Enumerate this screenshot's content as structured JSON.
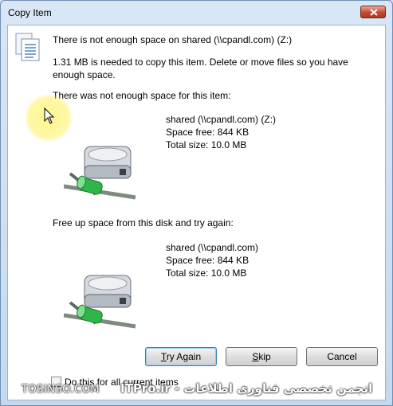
{
  "window": {
    "title": "Copy Item"
  },
  "message": {
    "main": "There is not enough space on shared (\\\\cpandl.com) (Z:)",
    "detail": "1.31 MB is needed to copy this item. Delete or move files so you have enough space."
  },
  "section1": {
    "heading": "There was not enough space for this item:",
    "drive_name": "shared (\\\\cpandl.com) (Z:)",
    "space_free": "Space free: 844 KB",
    "total_size": "Total size: 10.0 MB"
  },
  "section2": {
    "heading": "Free up space from this disk and try again:",
    "drive_name": "shared (\\\\cpandl.com)",
    "space_free": "Space free: 844 KB",
    "total_size": "Total size: 10.0 MB"
  },
  "buttons": {
    "try_again_accel": "T",
    "try_again_rest": "ry Again",
    "skip_accel": "S",
    "skip_rest": "kip",
    "cancel": "Cancel"
  },
  "checkbox": {
    "label": "Do this for all current items"
  },
  "watermark": {
    "left": "TOSINSO.COM",
    "right": "انجمن تخصصی فناوری اطلاعات - ITPro.ir"
  },
  "icons": {
    "close": "close-icon",
    "document": "copy-document-icon",
    "drive": "network-drive-icon",
    "cursor": "mouse-pointer-icon"
  },
  "colors": {
    "drive_green": "#2fb54a",
    "close_red": "#c24a33",
    "default_button_border": "#3c7fb1"
  }
}
